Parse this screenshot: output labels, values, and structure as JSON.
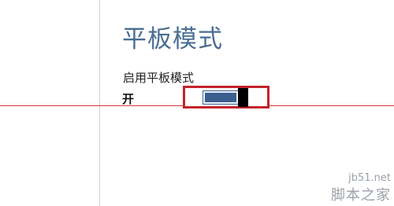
{
  "page": {
    "title": "平板模式"
  },
  "setting": {
    "label": "启用平板模式",
    "state": "开",
    "enabled": true
  },
  "watermark": {
    "url": "jb51.net",
    "name": "脚本之家"
  },
  "colors": {
    "title": "#4a6e93",
    "toggle_fill": "#3b5f8f",
    "highlight": "#c3232b"
  }
}
